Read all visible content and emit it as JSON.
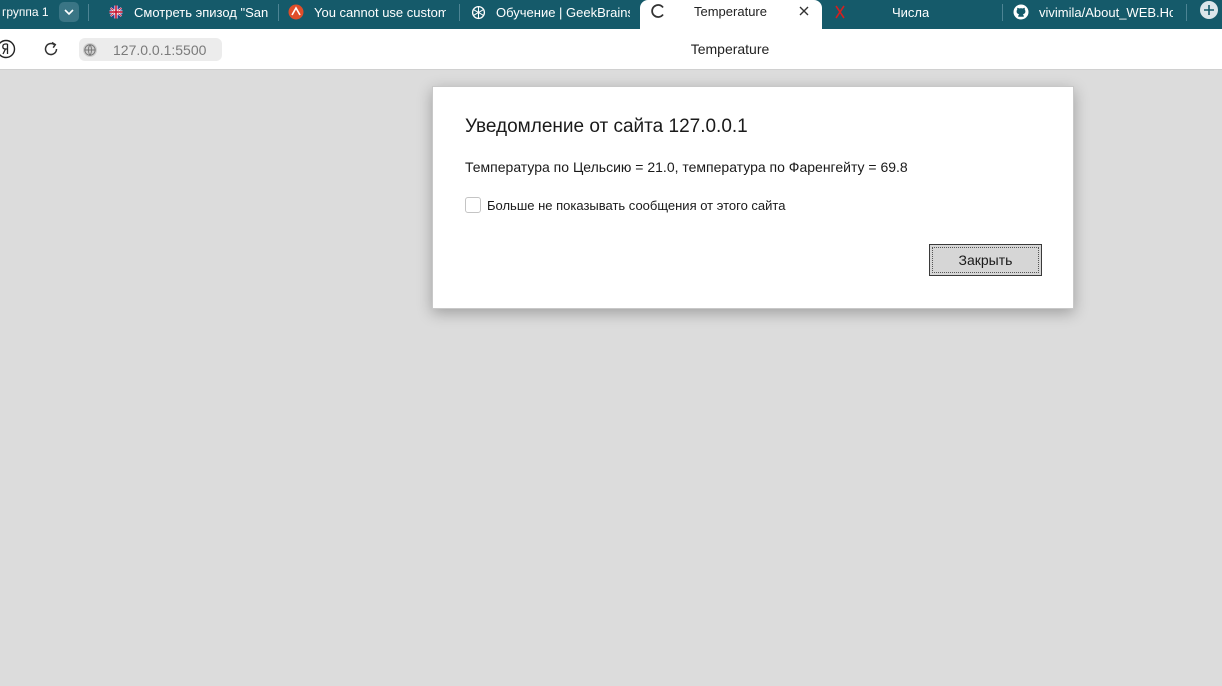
{
  "browser": {
    "tab_group": {
      "label": "группа 1"
    },
    "tabs": [
      {
        "title": "Смотреть эпизод \"Sanc",
        "icon": "uk-flag-icon"
      },
      {
        "title": "You cannot use custom",
        "icon": "brand-logo-icon"
      },
      {
        "title": "Обучение | GeekBrains",
        "icon": "openai-icon"
      },
      {
        "title": "Temperature",
        "icon": "loading-spinner-icon",
        "active": true
      },
      {
        "title": "Числа",
        "icon": "red-x-icon"
      },
      {
        "title": "vivimila/About_WEB.Ho",
        "icon": "github-icon"
      }
    ],
    "address": {
      "url": "127.0.0.1:5500",
      "page_title": "Temperature"
    }
  },
  "dialog": {
    "title": "Уведомление от сайта 127.0.0.1",
    "message": "Температура по Цельсию = 21.0, температура по Фаренгейту = 69.8",
    "checkbox_label": "Больше не показывать сообщения от этого сайта",
    "checkbox_checked": false,
    "close_label": "Закрыть"
  },
  "colors": {
    "tabstrip_bg": "#155a6a",
    "page_bg": "#dcdcdc"
  }
}
